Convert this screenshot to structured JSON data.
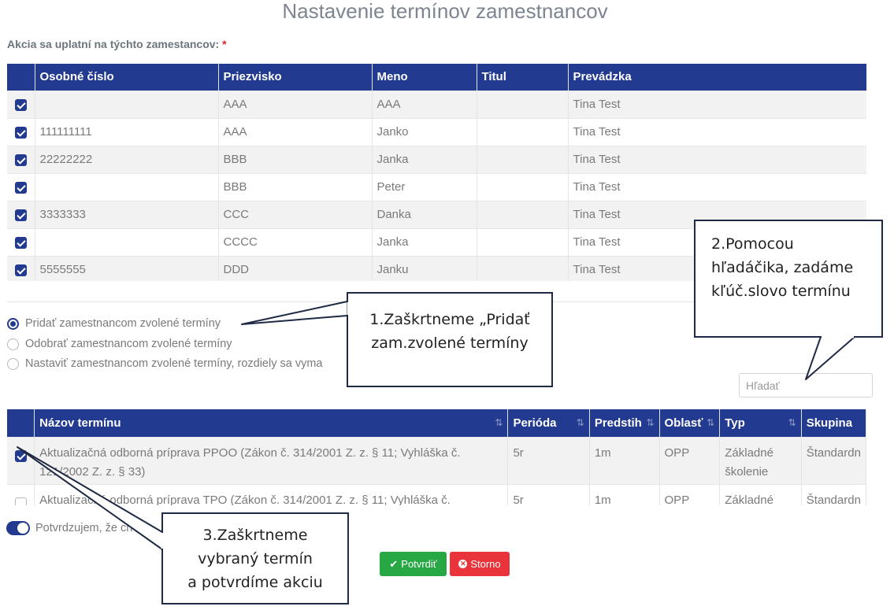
{
  "page": {
    "title": "Nastavenie termínov zamestnancov",
    "employees_label": "Akcia sa uplatní na týchto zamestancov:",
    "required_mark": "*"
  },
  "employee_table": {
    "headers": [
      "Osobné číslo",
      "Priezvisko",
      "Meno",
      "Titul",
      "Prevádzka"
    ],
    "rows": [
      {
        "checked": true,
        "osobne_cislo": "",
        "priezvisko": "AAA",
        "meno": "AAA",
        "titul": "",
        "prevadzka": "Tina Test"
      },
      {
        "checked": true,
        "osobne_cislo": "111111111",
        "priezvisko": "AAA",
        "meno": "Janko",
        "titul": "",
        "prevadzka": "Tina Test"
      },
      {
        "checked": true,
        "osobne_cislo": "22222222",
        "priezvisko": "BBB",
        "meno": "Janka",
        "titul": "",
        "prevadzka": "Tina Test"
      },
      {
        "checked": true,
        "osobne_cislo": "",
        "priezvisko": "BBB",
        "meno": "Peter",
        "titul": "",
        "prevadzka": "Tina Test"
      },
      {
        "checked": true,
        "osobne_cislo": "3333333",
        "priezvisko": "CCC",
        "meno": "Danka",
        "titul": "",
        "prevadzka": "Tina Test"
      },
      {
        "checked": true,
        "osobne_cislo": "",
        "priezvisko": "CCCC",
        "meno": "Janka",
        "titul": "",
        "prevadzka": "Tina Test"
      },
      {
        "checked": true,
        "osobne_cislo": "5555555",
        "priezvisko": "DDD",
        "meno": "Janku",
        "titul": "",
        "prevadzka": "Tina Test"
      }
    ]
  },
  "action_options": [
    {
      "label": "Pridať zamestnancom zvolené termíny",
      "selected": true
    },
    {
      "label": "Odobrať zamestnancom zvolené termíny",
      "selected": false
    },
    {
      "label": "Nastaviť zamestnancom zvolené termíny, rozdiely sa vyma",
      "selected": false
    }
  ],
  "search": {
    "placeholder": "Hľadať",
    "value": ""
  },
  "term_table": {
    "headers": [
      "Názov termínu",
      "Perióda",
      "Predstih",
      "Oblasť",
      "Typ",
      "Skupina"
    ],
    "rows": [
      {
        "checked": true,
        "nazov": "Aktualizačná odborná príprava PPOO (Zákon č. 314/2001 Z. z. § 11; Vyhláška č. 121/2002 Z. z. § 33)",
        "perioda": "5r",
        "predstih": "1m",
        "oblast": "OPP",
        "typ": "Základné školenie",
        "skupina": "Štandardn"
      },
      {
        "checked": false,
        "nazov": "Aktualizačná odborná príprava TPO (Zákon č. 314/2001 Z. z. § 11; Vyhláška č.",
        "perioda": "5r",
        "predstih": "1m",
        "oblast": "OPP",
        "typ": "Základné",
        "skupina": "Štandardn"
      }
    ]
  },
  "confirm_toggle": {
    "label": "Potvrdzujem, že ch",
    "on": true
  },
  "buttons": {
    "confirm": "Potvrdiť",
    "cancel": "Storno"
  },
  "callouts": {
    "step1": [
      "1.Zaškrtneme „Pridať",
      "zam.zvolené termíny"
    ],
    "step2": [
      "2.Pomocou",
      "hľadáčika, zadáme",
      "kľúč.slovo termínu"
    ],
    "step3": [
      "3.Zaškrtneme",
      "vybraný termín",
      "a potvrdíme akciu"
    ]
  },
  "colors": {
    "header": "#223a8f",
    "confirm": "#28a745",
    "cancel": "#e8343a"
  }
}
